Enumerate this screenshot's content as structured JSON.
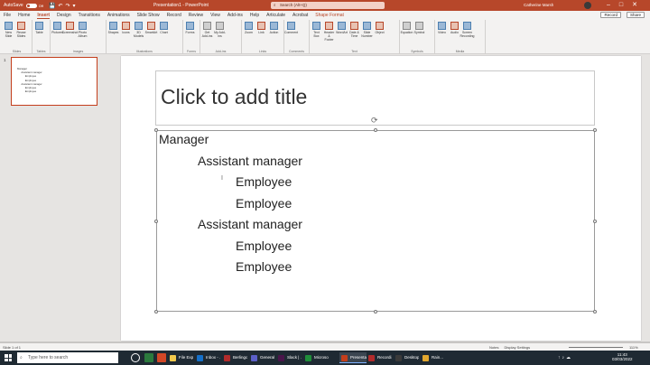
{
  "titlebar": {
    "autosave": "AutoSave",
    "toggle": "Off",
    "doc_title": "Presentation1 - PowerPoint",
    "search": "Search (Alt+Q)",
    "user": "Catherine Marsh",
    "brand_color": "#b7472a"
  },
  "tabs": [
    "File",
    "Home",
    "Insert",
    "Design",
    "Transitions",
    "Animations",
    "Slide Show",
    "Record",
    "Review",
    "View",
    "Add-ins",
    "Help",
    "Articulate",
    "Acrobat",
    "Shape Format"
  ],
  "active_tab": "Insert",
  "tab_right": {
    "record": "Record",
    "share": "Share"
  },
  "ribbon": {
    "groups": [
      {
        "name": "Slides",
        "buttons": [
          "New Slide",
          "Reuse Slides"
        ]
      },
      {
        "name": "Tables",
        "buttons": [
          "Table"
        ]
      },
      {
        "name": "Images",
        "buttons": [
          "Pictures",
          "Screenshot",
          "Photo Album"
        ]
      },
      {
        "name": "Illustrations",
        "buttons": [
          "Shapes",
          "Icons",
          "3D Models",
          "SmartArt",
          "Chart"
        ]
      },
      {
        "name": "Forms",
        "buttons": [
          "Forms"
        ]
      },
      {
        "name": "Add-ins",
        "buttons": [
          "Get Add-ins",
          "My Add-ins"
        ]
      },
      {
        "name": "Links",
        "buttons": [
          "Zoom",
          "Link",
          "Action"
        ]
      },
      {
        "name": "Comments",
        "buttons": [
          "Comment"
        ]
      },
      {
        "name": "Text",
        "buttons": [
          "Text Box",
          "Header & Footer",
          "WordArt",
          "Date & Time",
          "Slide Number",
          "Object"
        ]
      },
      {
        "name": "Symbols",
        "buttons": [
          "Equation",
          "Symbol"
        ]
      },
      {
        "name": "Media",
        "buttons": [
          "Video",
          "Audio",
          "Screen Recording"
        ]
      }
    ]
  },
  "thumbnail": {
    "number": "1",
    "lines": [
      "Manager",
      "Assistant manager",
      "Employee",
      "Employee",
      "Assistant manager",
      "Employee",
      "Employee"
    ]
  },
  "slide": {
    "title_placeholder": "Click to add title",
    "bullets": [
      {
        "text": "Manager",
        "level": 0
      },
      {
        "text": "Assistant manager",
        "level": 1
      },
      {
        "text": "Employee",
        "level": 2
      },
      {
        "text": "Employee",
        "level": 2
      },
      {
        "text": "Assistant manager",
        "level": 1
      },
      {
        "text": "Employee",
        "level": 2
      },
      {
        "text": "Employee",
        "level": 2
      }
    ]
  },
  "statusbar": {
    "slide_info": "Slide 1 of 1",
    "notes": "Notes",
    "display": "Display Settings",
    "zoom": "111%"
  },
  "taskbar": {
    "search": "Type here to search",
    "apps": [
      "File Explo...",
      "Inbox - ...",
      "Berlingo...",
      "General ...",
      "Slack | ...",
      "Microso...",
      "Presenta...",
      "Recordi...",
      "Desktop",
      "Rain..."
    ],
    "time": "11:43",
    "date": "03/03/2022"
  }
}
